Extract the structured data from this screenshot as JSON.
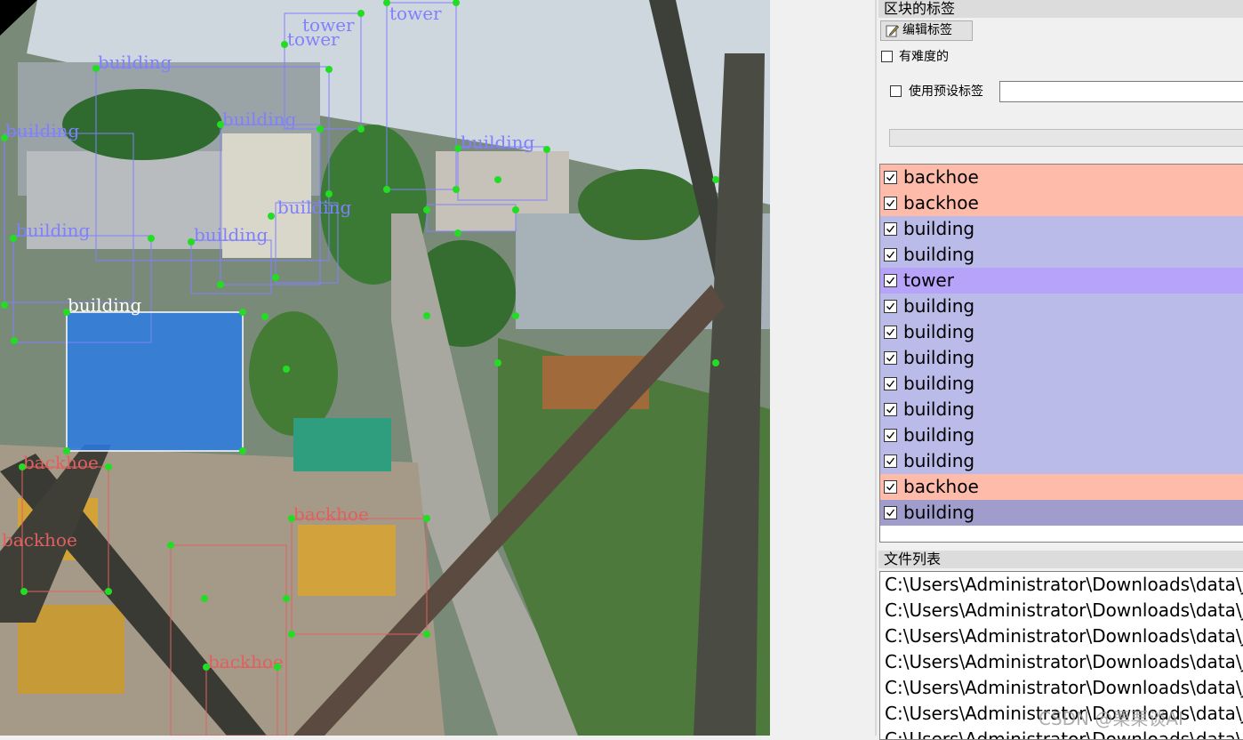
{
  "canvas": {
    "annotations": [
      {
        "label": "tower",
        "color": "#8080ff"
      },
      {
        "label": "tower",
        "color": "#8080ff"
      },
      {
        "label": "tower",
        "color": "#8080ff"
      },
      {
        "label": "building",
        "color": "#8080ff"
      },
      {
        "label": "building",
        "color": "#8080ff"
      },
      {
        "label": "building",
        "color": "#8080ff"
      },
      {
        "label": "building",
        "color": "#8080ff"
      },
      {
        "label": "building",
        "color": "#8080ff"
      },
      {
        "label": "building",
        "color": "#8080ff"
      },
      {
        "label": "building",
        "color": "#8080ff"
      },
      {
        "label": "building",
        "color": "#ffffff"
      },
      {
        "label": "backhoe",
        "color": "#e06060"
      },
      {
        "label": "backhoe",
        "color": "#e06060"
      },
      {
        "label": "backhoe",
        "color": "#e06060"
      },
      {
        "label": "backhoe",
        "color": "#e06060"
      }
    ]
  },
  "label_panel": {
    "title": "区块的标签",
    "edit_button": "编辑标签",
    "difficult_label": "有难度的",
    "use_preset_label": "使用预设标签",
    "preset_value": ""
  },
  "labels": [
    {
      "text": "backhoe",
      "bg": "#ffbbaa"
    },
    {
      "text": "backhoe",
      "bg": "#ffbbaa"
    },
    {
      "text": "building",
      "bg": "#bbbbea"
    },
    {
      "text": "building",
      "bg": "#bbbbea"
    },
    {
      "text": "tower",
      "bg": "#b7a4fa"
    },
    {
      "text": "building",
      "bg": "#bbbbea"
    },
    {
      "text": "building",
      "bg": "#bbbbea"
    },
    {
      "text": "building",
      "bg": "#bbbbea"
    },
    {
      "text": "building",
      "bg": "#bbbbea"
    },
    {
      "text": "building",
      "bg": "#bbbbea"
    },
    {
      "text": "building",
      "bg": "#bbbbea"
    },
    {
      "text": "building",
      "bg": "#bbbbea"
    },
    {
      "text": "backhoe",
      "bg": "#ffbbaa"
    },
    {
      "text": "building",
      "bg": "#a09ccc"
    }
  ],
  "file_panel": {
    "title": "文件列表",
    "files": [
      "C:\\Users\\Administrator\\Downloads\\data\\JP",
      "C:\\Users\\Administrator\\Downloads\\data\\JP",
      "C:\\Users\\Administrator\\Downloads\\data\\JP",
      "C:\\Users\\Administrator\\Downloads\\data\\JP",
      "C:\\Users\\Administrator\\Downloads\\data\\JP",
      "C:\\Users\\Administrator\\Downloads\\data\\JP",
      "C:\\Users\\Administrator\\Downloads\\data\\JP"
    ]
  },
  "watermark": "CSDN @栗栗谈AI"
}
